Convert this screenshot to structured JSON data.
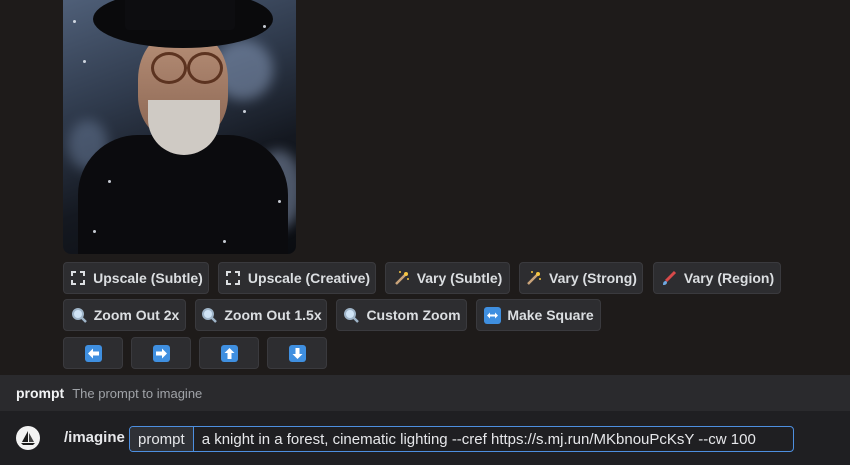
{
  "buttons_row1": [
    {
      "label": "Upscale (Subtle)",
      "icon": "expand-icon"
    },
    {
      "label": "Upscale (Creative)",
      "icon": "expand-icon"
    },
    {
      "label": "Vary (Subtle)",
      "icon": "magic-wand-icon"
    },
    {
      "label": "Vary (Strong)",
      "icon": "magic-wand-icon"
    },
    {
      "label": "Vary (Region)",
      "icon": "paintbrush-icon"
    }
  ],
  "buttons_row2": [
    {
      "label": "Zoom Out 2x",
      "icon": "magnifier-icon"
    },
    {
      "label": "Zoom Out 1.5x",
      "icon": "magnifier-icon"
    },
    {
      "label": "Custom Zoom",
      "icon": "magnifier-icon"
    },
    {
      "label": "Make Square",
      "icon": "left-right-arrow-icon"
    }
  ],
  "pan_buttons": [
    {
      "icon": "arrow-left-icon"
    },
    {
      "icon": "arrow-right-icon"
    },
    {
      "icon": "arrow-up-icon"
    },
    {
      "icon": "arrow-down-icon"
    }
  ],
  "hint": {
    "option_name": "prompt",
    "option_description": "The prompt to imagine"
  },
  "input": {
    "command": "/imagine",
    "option_tag": "prompt",
    "value": "a knight in a forest, cinematic lighting  --cref https://s.mj.run/MKbnouPcKsY --cw 100"
  },
  "colors": {
    "background": "#1e1b1a",
    "button": "#2d2d30",
    "accent_blue": "#3f8fe0",
    "input_border": "#4d8fe0"
  }
}
